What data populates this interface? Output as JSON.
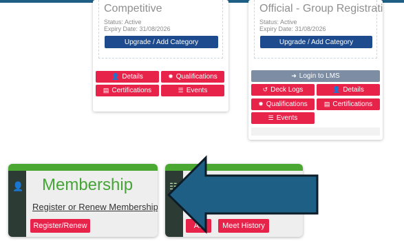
{
  "colors": {
    "brand_blue": "#1e4b8e",
    "action_red": "#e8234a",
    "lms_gray": "#7d8ea4",
    "tile_green": "#4aa832",
    "tile_sidebar": "#2c3b33",
    "arrow_fill": "#1e5f85"
  },
  "cards": [
    {
      "title": "Competitive",
      "status": "Status: Active",
      "expiry": "Expiry Date: 31/08/2026",
      "upgrade_label": "Upgrade / Add Category",
      "buttons": {
        "details": "Details",
        "qualifications": "Qualifications",
        "certifications": "Certifications",
        "events": "Events"
      }
    },
    {
      "title": "Official - Group Registration",
      "status": "Status: Active",
      "expiry": "Expiry Date: 31/08/2026",
      "upgrade_label": "Upgrade / Add Category",
      "lms_label": "Login to LMS",
      "buttons": {
        "deck_logs": "Deck Logs",
        "details": "Details",
        "qualifications": "Qualifications",
        "certifications": "Certifications",
        "events": "Events"
      }
    }
  ],
  "tiles": {
    "membership": {
      "icon": "user-edit-icon",
      "title": "Membership",
      "link": "Register or Renew Membership",
      "button": "Register/Renew"
    },
    "meets": {
      "icon": "list-icon",
      "add_button": "Ad",
      "history_button": "Meet History"
    }
  },
  "overlay": {
    "arrow_icon": "left-arrow-annotation"
  }
}
